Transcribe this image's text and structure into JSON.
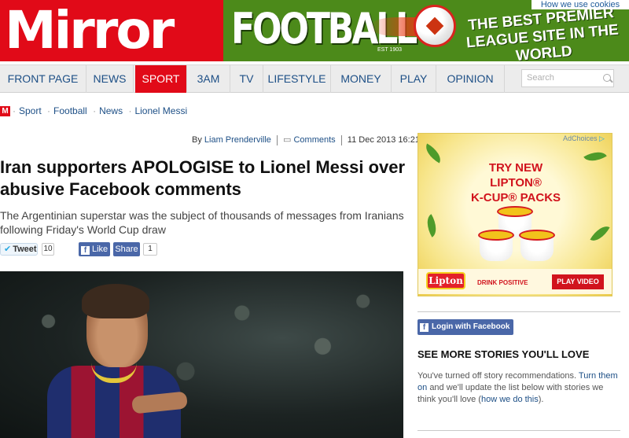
{
  "header": {
    "logo_text": "Mirror",
    "football_text": "FOOTBALL",
    "est_text": "EST 1903",
    "tagline": "THE BEST PREMIER LEAGUE SITE IN THE WORLD",
    "cookies_link": "How we use cookies",
    "brand_red": "#e10a18",
    "football_green": "#4c8a1a"
  },
  "nav": {
    "items": [
      "FRONT PAGE",
      "NEWS",
      "SPORT",
      "3AM",
      "TV",
      "LIFESTYLE",
      "MONEY",
      "PLAY",
      "OPINION"
    ],
    "active": "SPORT",
    "search_placeholder": "Search"
  },
  "breadcrumb": {
    "badge": "M",
    "items": [
      "Sport",
      "Football",
      "News",
      "Lionel Messi"
    ]
  },
  "article": {
    "byline_prefix": "By",
    "author": "Liam Prenderville",
    "comments_label": "Comments",
    "date": "11 Dec 2013 16:21",
    "headline": "Iran supporters APOLOGISE to Lionel Messi over abusive Facebook comments",
    "standfirst": "The Argentinian superstar was the subject of thousands of messages from Iranians following Friday's World Cup draw",
    "photo_icon": "messi-photo"
  },
  "social": {
    "tweet_label": "Tweet",
    "tweet_count": "10",
    "like_label": "Like",
    "share_label": "Share",
    "share_count": "1"
  },
  "ad": {
    "adchoices": "AdChoices",
    "title_line1": "TRY NEW",
    "title_line2": "LIPTON® ",
    "title_line3": "K-CUP® PACKS",
    "logo": "Lipton",
    "drink_positive": "DRINK POSITIVE",
    "play_video": "PLAY VIDEO",
    "cup_label": "Lipton"
  },
  "sidebar": {
    "login_facebook": "Login with Facebook",
    "see_more": "SEE MORE STORIES YOU'LL LOVE",
    "reco_text_1": "You've turned off story recommendations.",
    "reco_link_1": "Turn them on",
    "reco_text_2": "and we'll update the list below with stories we think you'll love (",
    "reco_link_2": "how we do this",
    "reco_text_3": ")."
  }
}
